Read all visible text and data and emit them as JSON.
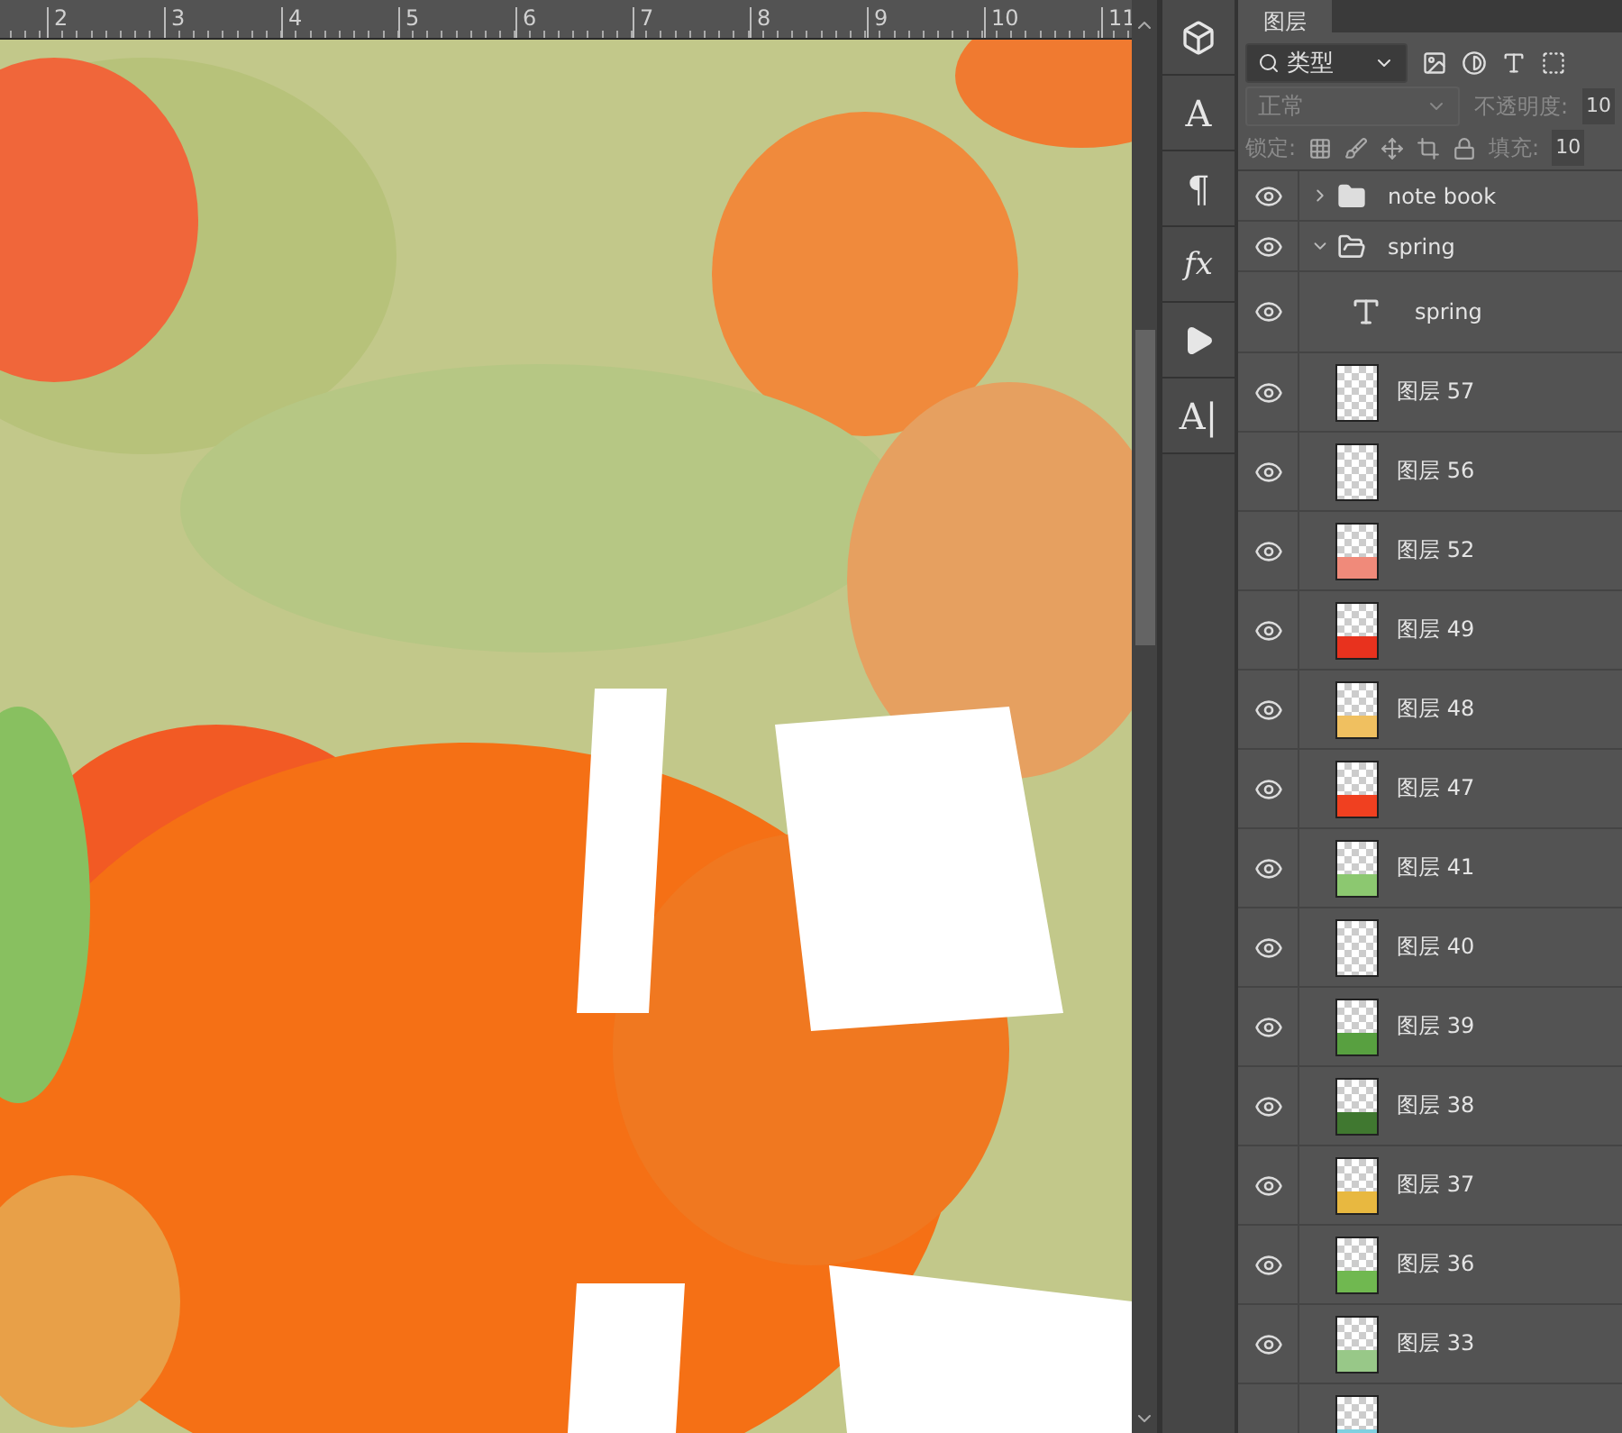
{
  "ruler": {
    "ticks": [
      "2",
      "3",
      "4",
      "5",
      "6",
      "7",
      "8",
      "9",
      "10",
      "11"
    ]
  },
  "tool_strip": [
    {
      "kind": "cube"
    },
    {
      "kind": "glyph",
      "glyph": "A"
    },
    {
      "kind": "glyph",
      "glyph": "¶"
    },
    {
      "kind": "fx",
      "glyph": "fx"
    },
    {
      "kind": "play"
    },
    {
      "kind": "glyph",
      "glyph": "A|"
    }
  ],
  "layers_panel": {
    "tab": {
      "label": "图层",
      "selected": true
    },
    "filter": {
      "value": "类型"
    },
    "blend_mode": {
      "value": "正常",
      "disabled": true
    },
    "opacity": {
      "label": "不透明度:",
      "value": "10"
    },
    "lock": {
      "label": "锁定:"
    },
    "fill": {
      "label": "填充:",
      "value": "10"
    },
    "layers": [
      {
        "kind": "group",
        "name": "note book",
        "visible": true,
        "expanded": false
      },
      {
        "kind": "group",
        "name": "spring",
        "visible": true,
        "expanded": true,
        "children": [
          {
            "kind": "text",
            "name": "spring",
            "visible": true
          },
          {
            "kind": "layer",
            "name": "图层 57",
            "visible": true
          },
          {
            "kind": "layer",
            "name": "图层 56",
            "visible": true
          },
          {
            "kind": "layer",
            "name": "图层 52",
            "visible": true,
            "color": "#f08a7a"
          },
          {
            "kind": "layer",
            "name": "图层 49",
            "visible": true,
            "color": "#e8321e"
          },
          {
            "kind": "layer",
            "name": "图层 48",
            "visible": true,
            "color": "#f0c060"
          },
          {
            "kind": "layer",
            "name": "图层 47",
            "visible": true,
            "color": "#f04020"
          },
          {
            "kind": "layer",
            "name": "图层 41",
            "visible": true,
            "color": "#8cc870"
          },
          {
            "kind": "layer",
            "name": "图层 40",
            "visible": true
          },
          {
            "kind": "layer",
            "name": "图层 39",
            "visible": true,
            "color": "#58a040"
          },
          {
            "kind": "layer",
            "name": "图层 38",
            "visible": true,
            "color": "#407830"
          },
          {
            "kind": "layer",
            "name": "图层 37",
            "visible": true,
            "color": "#e8b840"
          },
          {
            "kind": "layer",
            "name": "图层 36",
            "visible": true,
            "color": "#70b850"
          },
          {
            "kind": "layer",
            "name": "图层 33",
            "visible": true,
            "color": "#98c888"
          },
          {
            "kind": "layer",
            "color": "#80d0e0"
          }
        ]
      }
    ]
  }
}
